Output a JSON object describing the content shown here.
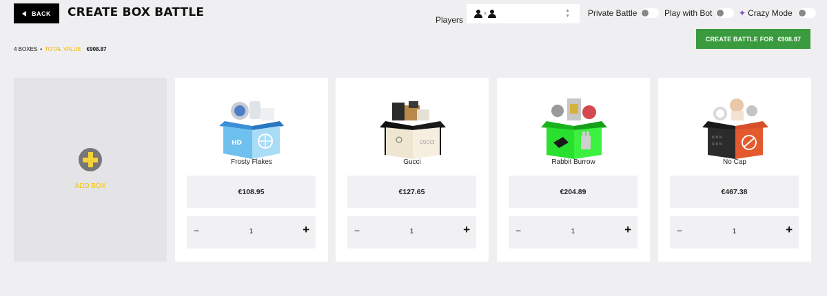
{
  "header": {
    "back_label": "BACK",
    "title": "CREATE BOX BATTLE"
  },
  "summary": {
    "box_count": "4 BOXES",
    "separator": "•",
    "total_value_label": "TOTAL VALUE",
    "total_value": "€908.87"
  },
  "players": {
    "label": "Players",
    "vs_symbol": "✕",
    "icon": "person-icon"
  },
  "toggles": {
    "private_battle": "Private Battle",
    "play_with_bot": "Play with Bot",
    "crazy_mode": "Crazy Mode"
  },
  "create_button": {
    "label": "CREATE BATTLE FOR",
    "amount": "€908.87",
    "color": "#3a9b3e"
  },
  "add_box": {
    "label": "ADD BOX",
    "accent": "#f5d23a"
  },
  "boxes": [
    {
      "name": "Frosty Flakes",
      "price": "€108.95",
      "quantity": "1",
      "box_color": "#5aaee6"
    },
    {
      "name": "Gucci",
      "price": "€127.65",
      "quantity": "1",
      "box_color": "#f0e8d6"
    },
    {
      "name": "Rabbit Burrow",
      "price": "€204.89",
      "quantity": "1",
      "box_color": "#25e02a"
    },
    {
      "name": "No Cap",
      "price": "€467.38",
      "quantity": "1",
      "box_color": "#2a2a2a"
    }
  ],
  "stepper": {
    "minus": "−",
    "plus": "+"
  }
}
